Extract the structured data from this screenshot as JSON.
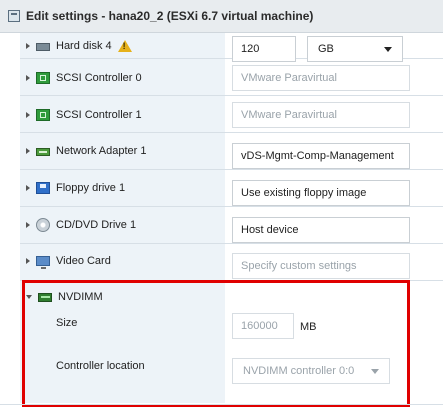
{
  "window": {
    "title": "Edit settings - hana20_2 (ESXi 6.7 virtual machine)"
  },
  "devices": [
    {
      "label": "Hard disk 4",
      "icon": "hard-disk-icon"
    },
    {
      "label": "SCSI Controller 0",
      "icon": "scsi-controller-icon"
    },
    {
      "label": "SCSI Controller 1",
      "icon": "scsi-controller-icon"
    },
    {
      "label": "Network Adapter 1",
      "icon": "network-adapter-icon"
    },
    {
      "label": "Floppy drive 1",
      "icon": "floppy-drive-icon"
    },
    {
      "label": "CD/DVD Drive 1",
      "icon": "cd-dvd-drive-icon"
    },
    {
      "label": "Video Card",
      "icon": "video-card-icon"
    },
    {
      "label": "NVDIMM",
      "icon": "nvdimm-icon"
    }
  ],
  "values": {
    "hard_disk_size": "120",
    "hard_disk_unit": "GB",
    "scsi0": "VMware Paravirtual",
    "scsi1": "VMware Paravirtual",
    "network": "vDS-Mgmt-Comp-Management",
    "floppy": "Use existing floppy image",
    "cddvd": "Host device",
    "video": "Specify custom settings"
  },
  "nvdimm": {
    "size_label": "Size",
    "size_value": "160000",
    "size_unit": "MB",
    "controller_location_label": "Controller location",
    "controller_location_value": "NVDIMM controller 0:0"
  },
  "colors": {
    "highlight": "#e00000",
    "left_panel_bg": "#edf3f8"
  }
}
